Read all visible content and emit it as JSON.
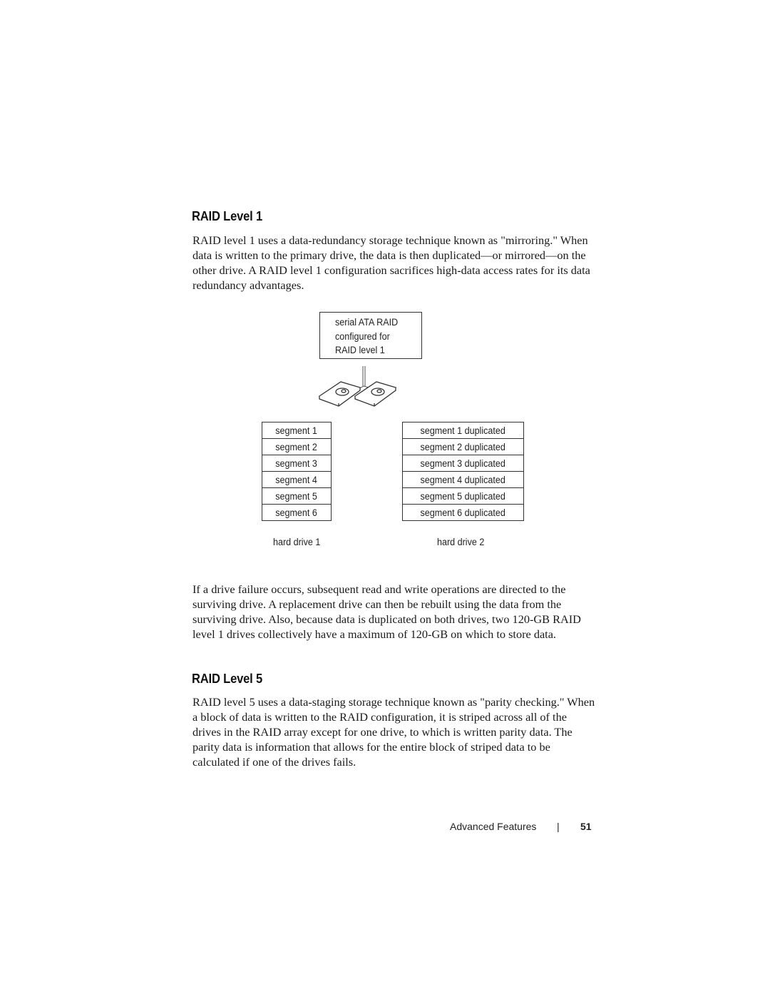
{
  "sections": {
    "raid1": {
      "heading": "RAID Level 1",
      "intro": "RAID level 1 uses a data-redundancy storage technique known as \"mirroring.\" When data is written to the primary drive, the data is then duplicated—or mirrored—on the other drive. A RAID level 1 configuration sacrifices high-data access rates for its data redundancy advantages.",
      "after_figure": "If a drive failure occurs, subsequent read and write operations are directed to the surviving drive. A replacement drive can then be rebuilt using the data from the surviving drive. Also, because data is duplicated on both drives, two 120-GB RAID level 1 drives collectively have a maximum of 120-GB on which to store data."
    },
    "raid5": {
      "heading": "RAID Level 5",
      "intro": "RAID level 5 uses a data-staging storage technique known as \"parity checking.\" When a block of data is written to the RAID configuration, it is striped across all of the drives in the RAID array except for one drive, to which is written parity data. The parity data is information that allows for the entire block of striped data to be calculated if one of the drives fails."
    }
  },
  "figure": {
    "controller_lines": [
      "serial ATA RAID",
      "configured for",
      "RAID level 1"
    ],
    "drive1": {
      "label": "hard drive 1",
      "segments": [
        "segment 1",
        "segment 2",
        "segment 3",
        "segment 4",
        "segment 5",
        "segment 6"
      ]
    },
    "drive2": {
      "label": "hard drive 2",
      "segments": [
        "segment 1 duplicated",
        "segment 2 duplicated",
        "segment 3 duplicated",
        "segment 4 duplicated",
        "segment 5 duplicated",
        "segment 6 duplicated"
      ]
    }
  },
  "footer": {
    "section_name": "Advanced Features",
    "separator": "|",
    "page_number": "51"
  }
}
